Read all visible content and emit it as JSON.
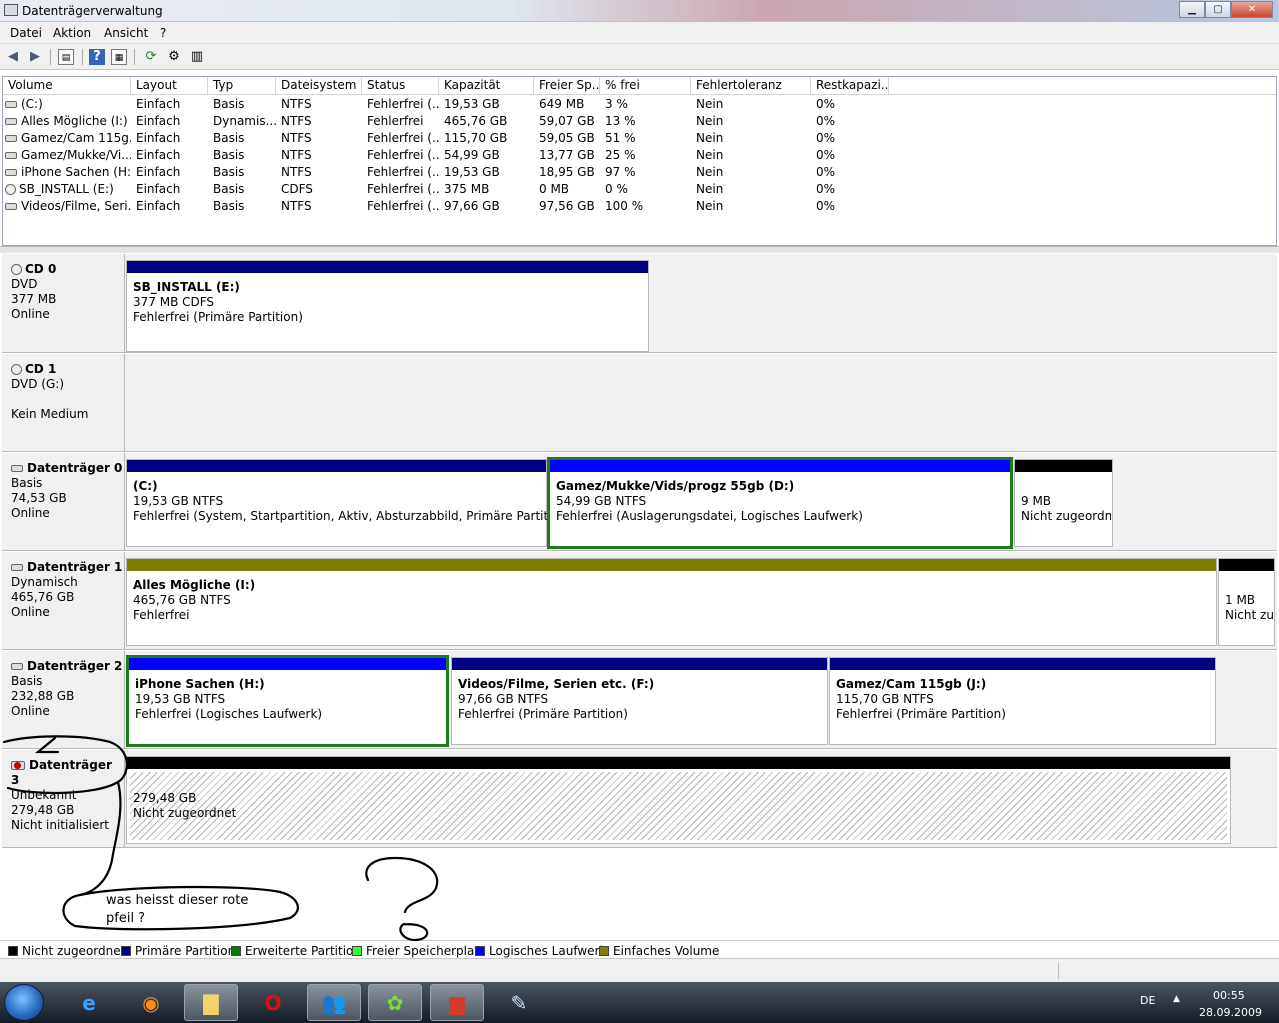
{
  "window": {
    "title": "Datenträgerverwaltung",
    "min": "▁",
    "max": "▢",
    "close": "✕"
  },
  "menu": [
    "Datei",
    "Aktion",
    "Ansicht",
    "?"
  ],
  "toolbar_icons": [
    "back-icon",
    "forward-icon",
    "properties-icon",
    "help-icon",
    "view-icon",
    "refresh-icon",
    "settings-icon",
    "list-icon"
  ],
  "volumes": {
    "columns": [
      "Volume",
      "Layout",
      "Typ",
      "Dateisystem",
      "Status",
      "Kapazität",
      "Freier Sp...",
      "% frei",
      "Fehlertoleranz",
      "Restkapazi..."
    ],
    "rows": [
      [
        "(C:)",
        "Einfach",
        "Basis",
        "NTFS",
        "Fehlerfrei (...",
        "19,53 GB",
        "649 MB",
        "3 %",
        "Nein",
        "0%"
      ],
      [
        "Alles Mögliche (I:)",
        "Einfach",
        "Dynamis...",
        "NTFS",
        "Fehlerfrei",
        "465,76 GB",
        "59,07 GB",
        "13 %",
        "Nein",
        "0%"
      ],
      [
        "Gamez/Cam 115g...",
        "Einfach",
        "Basis",
        "NTFS",
        "Fehlerfrei (...",
        "115,70 GB",
        "59,05 GB",
        "51 %",
        "Nein",
        "0%"
      ],
      [
        "Gamez/Mukke/Vi...",
        "Einfach",
        "Basis",
        "NTFS",
        "Fehlerfrei (...",
        "54,99 GB",
        "13,77 GB",
        "25 %",
        "Nein",
        "0%"
      ],
      [
        "iPhone Sachen (H:)",
        "Einfach",
        "Basis",
        "NTFS",
        "Fehlerfrei (...",
        "19,53 GB",
        "18,95 GB",
        "97 %",
        "Nein",
        "0%"
      ],
      [
        "SB_INSTALL (E:)",
        "Einfach",
        "Basis",
        "CDFS",
        "Fehlerfrei (...",
        "375 MB",
        "0 MB",
        "0 %",
        "Nein",
        "0%"
      ],
      [
        "Videos/Filme, Seri...",
        "Einfach",
        "Basis",
        "NTFS",
        "Fehlerfrei (...",
        "97,66 GB",
        "97,56 GB",
        "100 %",
        "Nein",
        "0%"
      ]
    ]
  },
  "disks": [
    {
      "name": "CD 0",
      "l1": "DVD",
      "l2": "377 MB",
      "l3": "Online",
      "parts": [
        {
          "title": "SB_INSTALL  (E:)",
          "l1": "377 MB CDFS",
          "l2": "Fehlerfrei (Primäre Partition)",
          "color": "#000080"
        }
      ]
    },
    {
      "name": "CD 1",
      "l1": "DVD (G:)",
      "l2": "",
      "l3": "Kein Medium",
      "parts": []
    },
    {
      "name": "Datenträger 0",
      "l1": "Basis",
      "l2": "74,53 GB",
      "l3": "Online",
      "parts": [
        {
          "title": "(C:)",
          "l1": "19,53 GB NTFS",
          "l2": "Fehlerfrei (System, Startpartition, Aktiv, Absturzabbild, Primäre Partition)",
          "color": "#000080"
        },
        {
          "title": "Gamez/Mukke/Vids/progz 55gb  (D:)",
          "l1": "54,99 GB NTFS",
          "l2": "Fehlerfrei (Auslagerungsdatei, Logisches Laufwerk)",
          "color": "#0000ff"
        },
        {
          "title": "",
          "l1": "9 MB",
          "l2": "Nicht zugeordnet",
          "color": "#000000"
        }
      ]
    },
    {
      "name": "Datenträger 1",
      "l1": "Dynamisch",
      "l2": "465,76 GB",
      "l3": "Online",
      "parts": [
        {
          "title": "Alles Mögliche  (I:)",
          "l1": "465,76 GB NTFS",
          "l2": "Fehlerfrei",
          "color": "#808000"
        },
        {
          "title": "",
          "l1": "1 MB",
          "l2": "Nicht zugeordnet",
          "color": "#000000"
        }
      ]
    },
    {
      "name": "Datenträger 2",
      "l1": "Basis",
      "l2": "232,88 GB",
      "l3": "Online",
      "parts": [
        {
          "title": "iPhone Sachen  (H:)",
          "l1": "19,53 GB NTFS",
          "l2": "Fehlerfrei (Logisches Laufwerk)",
          "color": "#0000ff"
        },
        {
          "title": "Videos/Filme, Serien etc.  (F:)",
          "l1": "97,66 GB NTFS",
          "l2": "Fehlerfrei (Primäre Partition)",
          "color": "#000080"
        },
        {
          "title": "Gamez/Cam 115gb  (J:)",
          "l1": "115,70 GB NTFS",
          "l2": "Fehlerfrei (Primäre Partition)",
          "color": "#000080"
        }
      ]
    },
    {
      "name": "Datenträger 3",
      "l1": "Unbekannt",
      "l2": "279,48 GB",
      "l3": "Nicht initialisiert",
      "parts": [
        {
          "title": "",
          "l1": "279,48 GB",
          "l2": "Nicht zugeordnet",
          "color": "#000000"
        }
      ]
    }
  ],
  "legend": [
    {
      "label": "Nicht zugeordnet",
      "color": "#000000"
    },
    {
      "label": "Primäre Partition",
      "color": "#000080"
    },
    {
      "label": "Erweiterte Partition",
      "color": "#008000"
    },
    {
      "label": "Freier Speicherplatz",
      "color": "#33ff33"
    },
    {
      "label": "Logisches Laufwerk",
      "color": "#0000ff"
    },
    {
      "label": "Einfaches Volume",
      "color": "#808000"
    }
  ],
  "annotation": {
    "note": "was heisst dieser rote pfeil ?",
    "question": "?"
  },
  "taskbar": {
    "start": "start-icon",
    "buttons": [
      "ie-icon",
      "firefox-icon",
      "explorer-icon",
      "opera-icon",
      "messenger-icon",
      "icq-icon",
      "toolbox-icon",
      "paint-icon"
    ],
    "lang": "DE",
    "time": "00:55",
    "date": "28.09.2009"
  }
}
